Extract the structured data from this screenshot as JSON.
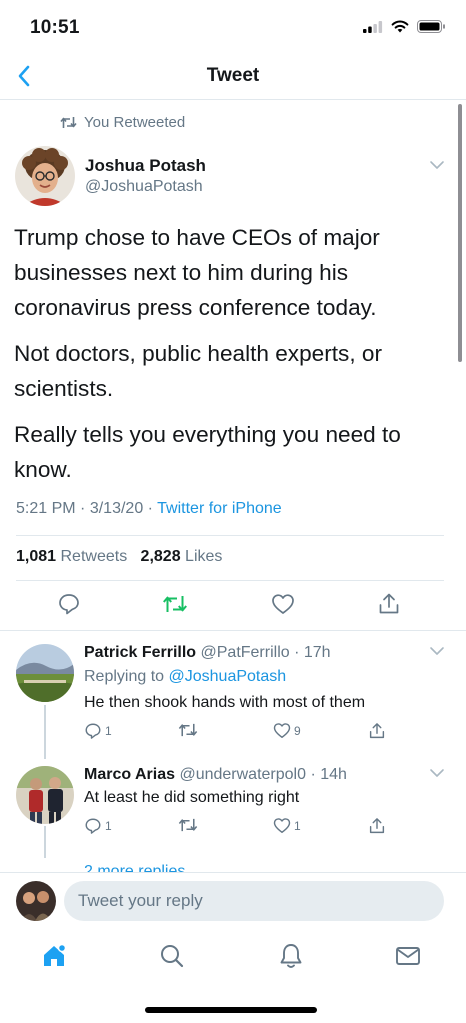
{
  "status_bar": {
    "time": "10:51"
  },
  "nav": {
    "title": "Tweet"
  },
  "retweet_context": {
    "label": "You Retweeted"
  },
  "tweet": {
    "author_name": "Joshua Potash",
    "author_handle": "@JoshuaPotash",
    "paragraphs": [
      "Trump chose to have CEOs of major businesses next to him during his coronavirus press conference today.",
      "Not doctors, public health experts, or scientists.",
      "Really tells you everything you need to know."
    ],
    "time": "5:21 PM",
    "date": "3/13/20",
    "source": "Twitter for iPhone",
    "retweets_count": "1,081",
    "retweets_label": "Retweets",
    "likes_count": "2,828",
    "likes_label": "Likes"
  },
  "replies": [
    {
      "name": "Patrick Ferrillo",
      "handle": "@PatFerrillo",
      "time": "17h",
      "replying_prefix": "Replying to",
      "replying_to": "@JoshuaPotash",
      "text": "He then shook hands with most of them",
      "reply_count": "1",
      "retweet_count": "",
      "like_count": "9"
    },
    {
      "name": "Marco Arias",
      "handle": "@underwaterpol0",
      "time": "14h",
      "text": "At least he did something right",
      "reply_count": "1",
      "retweet_count": "",
      "like_count": "1"
    }
  ],
  "more_replies": "2 more replies",
  "compose": {
    "placeholder": "Tweet your reply"
  },
  "colors": {
    "accent": "#1da1f2",
    "retweet_green": "#17bf63",
    "muted": "#657786"
  },
  "tab_bar": {
    "icons": [
      "home-icon",
      "search-icon",
      "notifications-icon",
      "messages-icon"
    ]
  }
}
